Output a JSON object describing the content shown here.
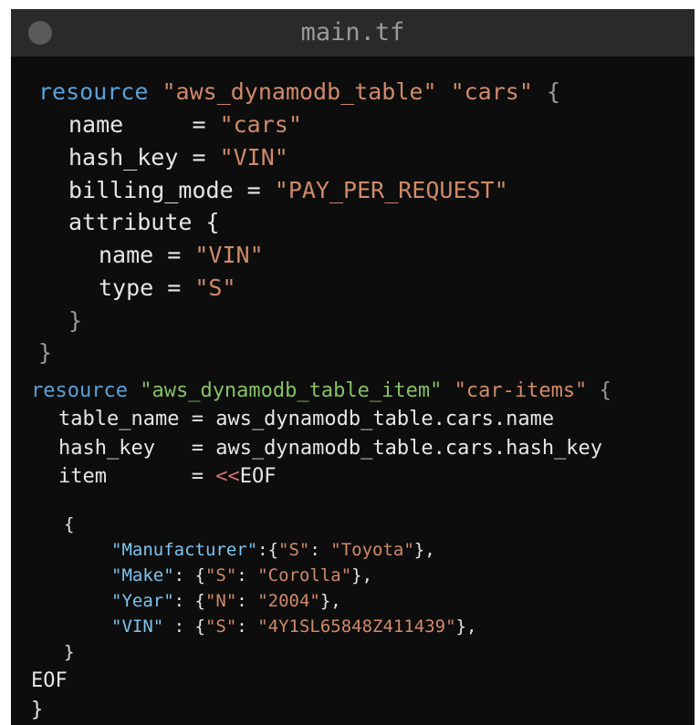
{
  "window": {
    "title": "main.tf"
  },
  "code": {
    "block1": {
      "keyword": "resource",
      "type": "\"aws_dynamodb_table\"",
      "name": "\"cars\"",
      "open": "{",
      "name_key": "name",
      "name_eq": "     = ",
      "name_val": "\"cars\"",
      "hash_key": "hash_key",
      "hash_eq": " = ",
      "hash_val": "\"VIN\"",
      "billing_key": "billing_mode",
      "billing_eq": " = ",
      "billing_val": "\"PAY_PER_REQUEST\"",
      "attr_key": "attribute",
      "attr_open": " {",
      "attr_name_key": "name",
      "attr_name_eq": " = ",
      "attr_name_val": "\"VIN\"",
      "attr_type_key": "type",
      "attr_type_eq": " = ",
      "attr_type_val": "\"S\"",
      "attr_close": "}",
      "close": "}"
    },
    "block2": {
      "keyword": "resource",
      "type": "\"aws_dynamodb_table_item\"",
      "name": "\"car-items\"",
      "open": "{",
      "table_name_key": "table_name",
      "table_name_eq": " = ",
      "table_name_val": "aws_dynamodb_table.cars.name",
      "hash_key": "hash_key",
      "hash_eq": "   = ",
      "hash_val": "aws_dynamodb_table.cars.hash_key",
      "item_key": "item",
      "item_eq": "       = ",
      "item_heredoc": "<<",
      "item_eof": "EOF",
      "json_open": "{",
      "rows": [
        {
          "key": "\"Manufacturer\"",
          "sep": ":{",
          "t": "\"S\"",
          "mid": ": ",
          "v": "\"Toyota\"",
          "end": "},"
        },
        {
          "key": "\"Make\"",
          "sep": ": {",
          "t": "\"S\"",
          "mid": ": ",
          "v": "\"Corolla\"",
          "end": "},"
        },
        {
          "key": "\"Year\"",
          "sep": ": {",
          "t": "\"N\"",
          "mid": ": ",
          "v": "\"2004\"",
          "end": "},"
        },
        {
          "key": "\"VIN\"",
          "sep": " : {",
          "t": "\"S\"",
          "mid": ": ",
          "v": "\"4Y1SL65848Z411439\"",
          "end": "},"
        }
      ],
      "json_close": "}",
      "eof": "EOF",
      "close": "}"
    }
  }
}
